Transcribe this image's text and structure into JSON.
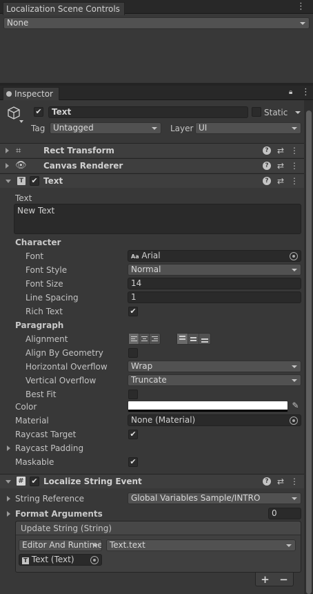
{
  "top_panel": {
    "tab_title": "Localization Scene Controls",
    "dropdown_value": "None"
  },
  "inspector": {
    "tab_title": "Inspector",
    "object": {
      "name": "Text",
      "static_label": "Static",
      "tag_label": "Tag",
      "tag_value": "Untagged",
      "layer_label": "Layer",
      "layer_value": "UI"
    },
    "components": {
      "rect_transform": "Rect Transform",
      "canvas_renderer": "Canvas Renderer",
      "text": "Text"
    },
    "text_component": {
      "text_label": "Text",
      "text_value": "New Text",
      "character_header": "Character",
      "font_label": "Font",
      "font_value": "Arial",
      "font_icon_text": "Aa",
      "font_style_label": "Font Style",
      "font_style_value": "Normal",
      "font_size_label": "Font Size",
      "font_size_value": "14",
      "line_spacing_label": "Line Spacing",
      "line_spacing_value": "1",
      "rich_text_label": "Rich Text",
      "paragraph_header": "Paragraph",
      "alignment_label": "Alignment",
      "align_by_geometry_label": "Align By Geometry",
      "horizontal_overflow_label": "Horizontal Overflow",
      "horizontal_overflow_value": "Wrap",
      "vertical_overflow_label": "Vertical Overflow",
      "vertical_overflow_value": "Truncate",
      "best_fit_label": "Best Fit",
      "color_label": "Color",
      "material_label": "Material",
      "material_value": "None (Material)",
      "raycast_target_label": "Raycast Target",
      "raycast_padding_label": "Raycast Padding",
      "maskable_label": "Maskable"
    },
    "localize": {
      "title": "Localize String Event",
      "string_reference_label": "String Reference",
      "string_reference_value": "Global Variables Sample/INTRO",
      "format_arguments_label": "Format Arguments",
      "format_arguments_count": "0",
      "event_title": "Update String (String)",
      "runtime_value": "Editor And Runtime",
      "function_value": "Text.text",
      "target_value": "Text (Text)",
      "add_label": "+",
      "remove_label": "−"
    }
  },
  "colors": {
    "text_color_swatch": "#ffffff"
  }
}
